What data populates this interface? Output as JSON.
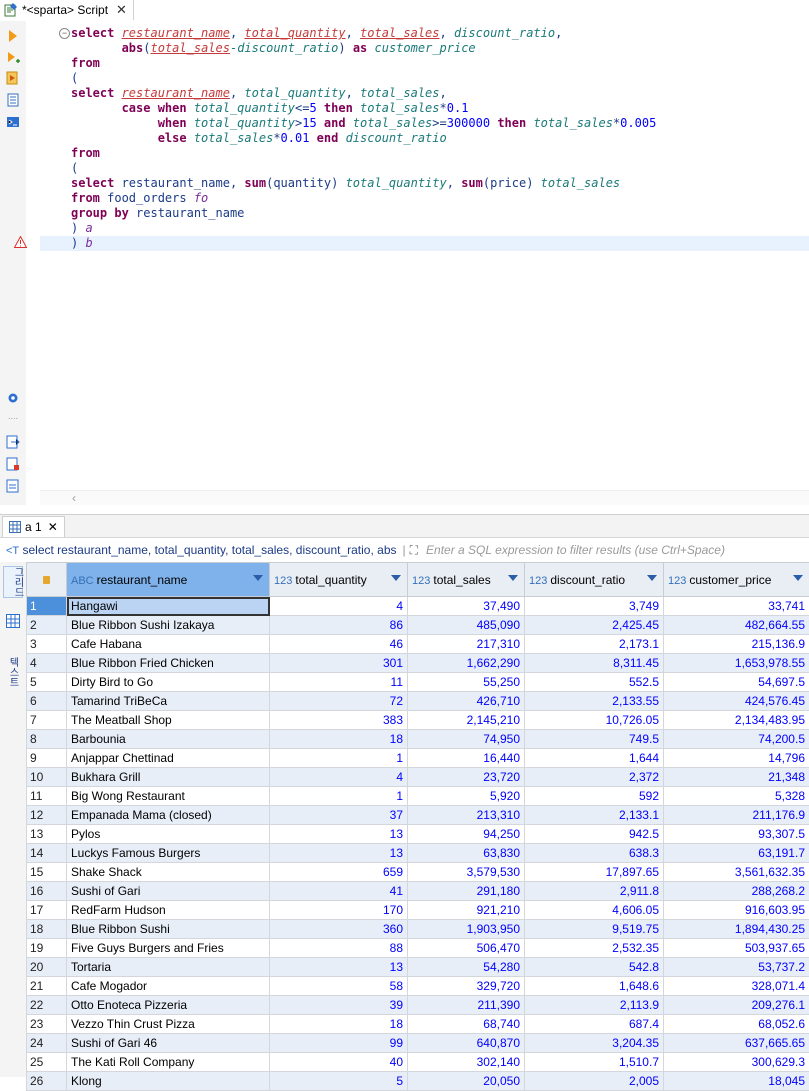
{
  "tab": {
    "title": "*<sparta> Script",
    "close": "✕"
  },
  "editor": {
    "lines": [
      [
        [
          "kw",
          "select "
        ],
        [
          "ul",
          "restaurant_name"
        ],
        [
          "id",
          ", "
        ],
        [
          "ul",
          "total_quantity"
        ],
        [
          "id",
          ", "
        ],
        [
          "ul",
          "total_sales"
        ],
        [
          "id",
          ", "
        ],
        [
          "al",
          "discount_ratio"
        ],
        [
          "id",
          ","
        ]
      ],
      [
        [
          "id",
          "       "
        ],
        [
          "fn",
          "abs"
        ],
        [
          "id",
          "("
        ],
        [
          "ul",
          "total_sales"
        ],
        [
          "al",
          "-discount_ratio"
        ],
        [
          "id",
          ") "
        ],
        [
          "kw",
          "as "
        ],
        [
          "al",
          "customer_price"
        ]
      ],
      [
        [
          "kw",
          "from"
        ]
      ],
      [
        [
          "id",
          "("
        ]
      ],
      [
        [
          "kw",
          "select "
        ],
        [
          "ul",
          "restaurant_name"
        ],
        [
          "id",
          ", "
        ],
        [
          "al",
          "total_quantity"
        ],
        [
          "id",
          ", "
        ],
        [
          "al",
          "total_sales"
        ],
        [
          "id",
          ","
        ]
      ],
      [
        [
          "id",
          "       "
        ],
        [
          "kw",
          "case when "
        ],
        [
          "al",
          "total_quantity"
        ],
        [
          "id",
          "<="
        ],
        [
          "num",
          "5"
        ],
        [
          "kw",
          " then "
        ],
        [
          "al",
          "total_sales"
        ],
        [
          "id",
          "*"
        ],
        [
          "num",
          "0.1"
        ]
      ],
      [
        [
          "id",
          "            "
        ],
        [
          "kw",
          "when "
        ],
        [
          "al",
          "total_quantity"
        ],
        [
          "id",
          ">"
        ],
        [
          "num",
          "15"
        ],
        [
          "kw",
          " and "
        ],
        [
          "al",
          "total_sales"
        ],
        [
          "id",
          ">="
        ],
        [
          "num",
          "300000"
        ],
        [
          "kw",
          " then "
        ],
        [
          "al",
          "total_sales"
        ],
        [
          "id",
          "*"
        ],
        [
          "num",
          "0.005"
        ]
      ],
      [
        [
          "id",
          "            "
        ],
        [
          "kw",
          "else "
        ],
        [
          "al",
          "total_sales"
        ],
        [
          "id",
          "*"
        ],
        [
          "num",
          "0.01"
        ],
        [
          "kw",
          " end "
        ],
        [
          "al",
          "discount_ratio"
        ]
      ],
      [
        [
          "kw",
          "from"
        ]
      ],
      [
        [
          "id",
          "("
        ]
      ],
      [
        [
          "kw",
          "select "
        ],
        [
          "id",
          "restaurant_name, "
        ],
        [
          "fn",
          "sum"
        ],
        [
          "id",
          "(quantity) "
        ],
        [
          "al",
          "total_quantity"
        ],
        [
          "id",
          ", "
        ],
        [
          "fn",
          "sum"
        ],
        [
          "id",
          "(price) "
        ],
        [
          "al",
          "total_sales"
        ]
      ],
      [
        [
          "kw",
          "from "
        ],
        [
          "id",
          "food_orders "
        ],
        [
          "tb",
          "fo"
        ]
      ],
      [
        [
          "kw",
          "group by "
        ],
        [
          "id",
          "restaurant_name"
        ]
      ],
      [
        [
          "id",
          ") "
        ],
        [
          "tb",
          "a"
        ]
      ],
      [
        [
          "id",
          ") "
        ],
        [
          "tb",
          "b"
        ]
      ]
    ]
  },
  "results": {
    "tab_label": "a 1",
    "tab_close": "✕",
    "query_text": "select restaurant_name, total_quantity, total_sales, discount_ratio, abs",
    "filter_placeholder": "Enter a SQL expression to filter results (use Ctrl+Space)",
    "side_labels": "그리드",
    "side_labels2": "텍스트",
    "columns": [
      {
        "type": "ABC",
        "name": "restaurant_name"
      },
      {
        "type": "123",
        "name": "total_quantity"
      },
      {
        "type": "123",
        "name": "total_sales"
      },
      {
        "type": "123",
        "name": "discount_ratio"
      },
      {
        "type": "123",
        "name": "customer_price"
      }
    ],
    "rows": [
      [
        "1",
        "Hangawi",
        "4",
        "37,490",
        "3,749",
        "33,741"
      ],
      [
        "2",
        "Blue Ribbon Sushi Izakaya",
        "86",
        "485,090",
        "2,425.45",
        "482,664.55"
      ],
      [
        "3",
        "Cafe Habana",
        "46",
        "217,310",
        "2,173.1",
        "215,136.9"
      ],
      [
        "4",
        "Blue Ribbon Fried Chicken",
        "301",
        "1,662,290",
        "8,311.45",
        "1,653,978.55"
      ],
      [
        "5",
        "Dirty Bird to Go",
        "11",
        "55,250",
        "552.5",
        "54,697.5"
      ],
      [
        "6",
        "Tamarind TriBeCa",
        "72",
        "426,710",
        "2,133.55",
        "424,576.45"
      ],
      [
        "7",
        "The Meatball Shop",
        "383",
        "2,145,210",
        "10,726.05",
        "2,134,483.95"
      ],
      [
        "8",
        "Barbounia",
        "18",
        "74,950",
        "749.5",
        "74,200.5"
      ],
      [
        "9",
        "Anjappar Chettinad",
        "1",
        "16,440",
        "1,644",
        "14,796"
      ],
      [
        "10",
        "Bukhara Grill",
        "4",
        "23,720",
        "2,372",
        "21,348"
      ],
      [
        "11",
        "Big Wong Restaurant",
        "1",
        "5,920",
        "592",
        "5,328"
      ],
      [
        "12",
        "Empanada Mama (closed)",
        "37",
        "213,310",
        "2,133.1",
        "211,176.9"
      ],
      [
        "13",
        "Pylos",
        "13",
        "94,250",
        "942.5",
        "93,307.5"
      ],
      [
        "14",
        "Luckys Famous Burgers",
        "13",
        "63,830",
        "638.3",
        "63,191.7"
      ],
      [
        "15",
        "Shake Shack",
        "659",
        "3,579,530",
        "17,897.65",
        "3,561,632.35"
      ],
      [
        "16",
        "Sushi of Gari",
        "41",
        "291,180",
        "2,911.8",
        "288,268.2"
      ],
      [
        "17",
        "RedFarm Hudson",
        "170",
        "921,210",
        "4,606.05",
        "916,603.95"
      ],
      [
        "18",
        "Blue Ribbon Sushi",
        "360",
        "1,903,950",
        "9,519.75",
        "1,894,430.25"
      ],
      [
        "19",
        "Five Guys Burgers and Fries",
        "88",
        "506,470",
        "2,532.35",
        "503,937.65"
      ],
      [
        "20",
        "Tortaria",
        "13",
        "54,280",
        "542.8",
        "53,737.2"
      ],
      [
        "21",
        "Cafe Mogador",
        "58",
        "329,720",
        "1,648.6",
        "328,071.4"
      ],
      [
        "22",
        "Otto Enoteca Pizzeria",
        "39",
        "211,390",
        "2,113.9",
        "209,276.1"
      ],
      [
        "23",
        "Vezzo Thin Crust Pizza",
        "18",
        "68,740",
        "687.4",
        "68,052.6"
      ],
      [
        "24",
        "Sushi of Gari 46",
        "99",
        "640,870",
        "3,204.35",
        "637,665.65"
      ],
      [
        "25",
        "The Kati Roll Company",
        "40",
        "302,140",
        "1,510.7",
        "300,629.3"
      ],
      [
        "26",
        "Klong",
        "5",
        "20,050",
        "2,005",
        "18,045"
      ]
    ]
  }
}
